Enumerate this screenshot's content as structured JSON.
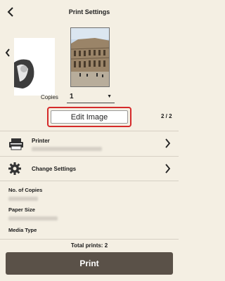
{
  "header": {
    "title": "Print Settings",
    "back_icon": "chevron-left-icon"
  },
  "preview": {
    "copies_label": "Copies",
    "copies_value": "1",
    "edit_image_label": "Edit Image",
    "page_indicator": "2 / 2"
  },
  "printer_row": {
    "label": "Printer",
    "icon": "printer-icon"
  },
  "settings_row": {
    "label": "Change Settings",
    "icon": "gear-icon"
  },
  "info": {
    "no_of_copies_label": "No. of Copies",
    "paper_size_label": "Paper Size",
    "media_type_label": "Media Type"
  },
  "footer": {
    "total_prints": "Total prints: 2",
    "print_label": "Print"
  },
  "colors": {
    "background": "#f4efe3",
    "print_button": "#5a5148",
    "highlight": "#d52a2a"
  }
}
